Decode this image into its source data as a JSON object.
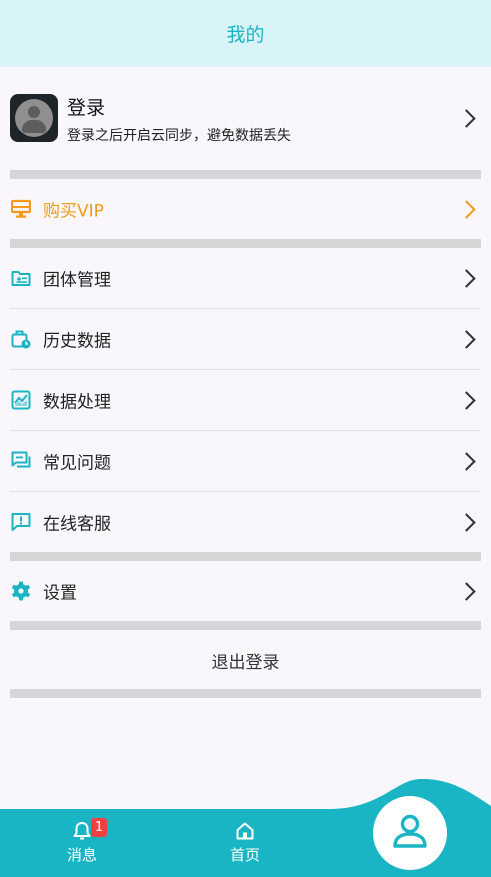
{
  "header": {
    "title": "我的"
  },
  "profile": {
    "title": "登录",
    "subtitle": "登录之后开启云同步，避免数据丢失"
  },
  "menu": {
    "vip": "购买VIP",
    "team": "团体管理",
    "history": "历史数据",
    "processing": "数据处理",
    "faq": "常见问题",
    "support": "在线客服",
    "settings": "设置",
    "logout": "退出登录"
  },
  "tabbar": {
    "messages": {
      "label": "消息",
      "badge": "1"
    },
    "home": {
      "label": "首页"
    }
  },
  "colors": {
    "accent": "#1ab5c5",
    "vip": "#f39a1a",
    "header_bg": "#d8f4f6",
    "badge": "#f04040"
  },
  "icons": {
    "avatar": "user-avatar",
    "vip": "monitor-icon",
    "team": "folder-id-icon",
    "history": "briefcase-clock-icon",
    "processing": "chart-icon",
    "faq": "chat-bubbles-icon",
    "support": "chat-exclaim-icon",
    "settings": "gear-icon",
    "messages": "bell-icon",
    "home": "home-icon",
    "profile": "user-icon"
  }
}
